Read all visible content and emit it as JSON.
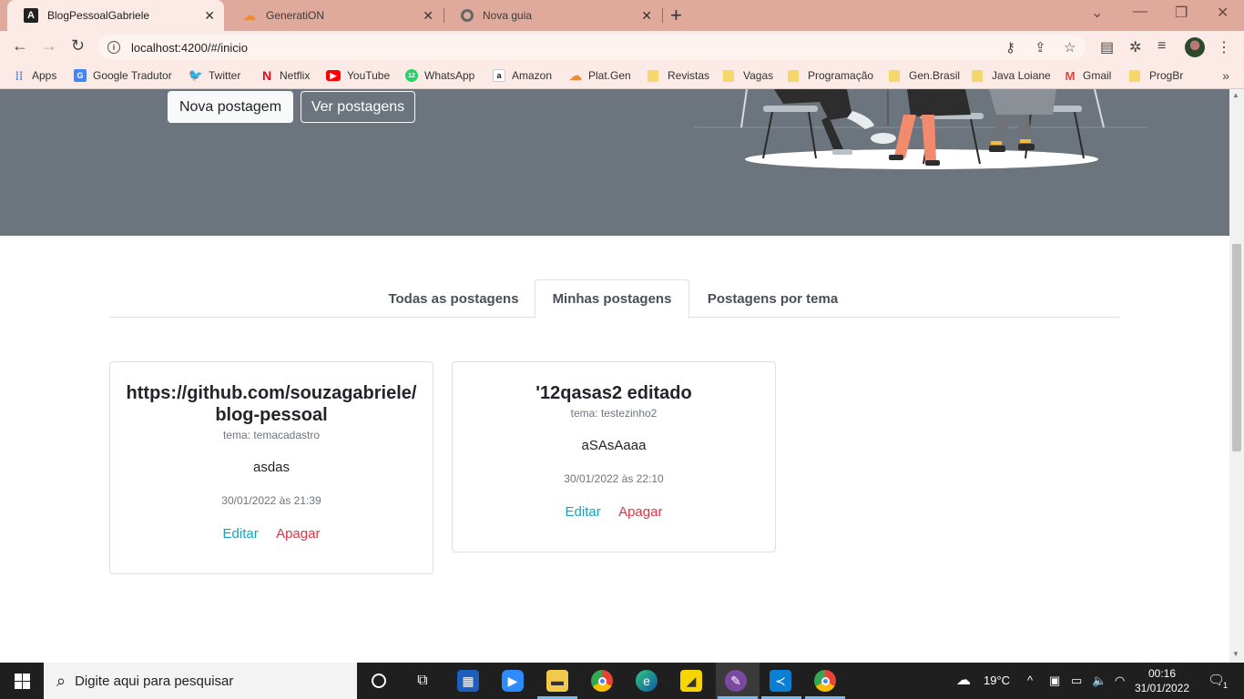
{
  "browser": {
    "tabs": [
      {
        "title": "BlogPessoalGabriele",
        "active": true
      },
      {
        "title": "GeneratiON",
        "active": false
      },
      {
        "title": "Nova guia",
        "active": false
      }
    ],
    "url": "localhost:4200/#/inicio",
    "bookmarks": [
      {
        "label": "Apps",
        "icon": "apps-grid-icon"
      },
      {
        "label": "Google Tradutor",
        "icon": "google-translate-icon"
      },
      {
        "label": "Twitter",
        "icon": "twitter-icon"
      },
      {
        "label": "Netflix",
        "icon": "netflix-icon"
      },
      {
        "label": "YouTube",
        "icon": "youtube-icon"
      },
      {
        "label": "WhatsApp",
        "icon": "whatsapp-icon"
      },
      {
        "label": "Amazon",
        "icon": "amazon-icon"
      },
      {
        "label": "Plat.Gen",
        "icon": "cloud-icon"
      },
      {
        "label": "Revistas",
        "icon": "folder-icon"
      },
      {
        "label": "Vagas",
        "icon": "folder-icon"
      },
      {
        "label": "Programação",
        "icon": "folder-icon"
      },
      {
        "label": "Gen.Brasil",
        "icon": "folder-icon"
      },
      {
        "label": "Java Loiane",
        "icon": "folder-icon"
      },
      {
        "label": "Gmail",
        "icon": "gmail-icon"
      },
      {
        "label": "ProgBr",
        "icon": "folder-icon"
      }
    ],
    "bookmarks_more": "»"
  },
  "hero": {
    "new_post_label": "Nova postagem",
    "view_posts_label": "Ver postagens"
  },
  "post_tabs": [
    {
      "label": "Todas as postagens",
      "active": false
    },
    {
      "label": "Minhas postagens",
      "active": true
    },
    {
      "label": "Postagens por tema",
      "active": false
    }
  ],
  "posts": [
    {
      "title": "https://github.com/souzagabriele/blog-pessoal",
      "tema": "tema: temacadastro",
      "text": "asdas",
      "date": "30/01/2022 às 21:39",
      "edit_label": "Editar",
      "delete_label": "Apagar"
    },
    {
      "title": "'12qasas2 editado",
      "tema": "tema: testezinho2",
      "text": "aSAsAaaa",
      "date": "30/01/2022 às 22:10",
      "edit_label": "Editar",
      "delete_label": "Apagar"
    }
  ],
  "taskbar": {
    "search_placeholder": "Digite aqui para pesquisar",
    "weather": "19°C",
    "time": "00:16",
    "date": "31/01/2022",
    "notifications_count": "1"
  },
  "colors": {
    "chrome_tabstrip": "#dfa99c",
    "chrome_toolbar": "#fbeae5",
    "hero_bg": "#6c757d",
    "edit_link": "#17a2b8",
    "delete_link": "#dc3545"
  }
}
